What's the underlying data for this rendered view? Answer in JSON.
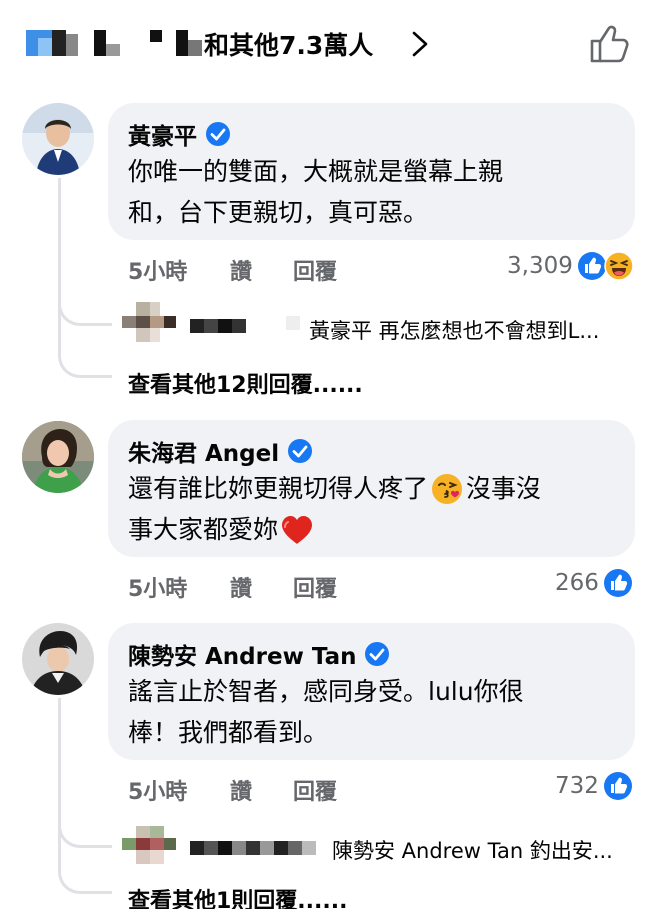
{
  "header": {
    "reactions_text": "和其他7.3萬人"
  },
  "comments": [
    {
      "author": "黃豪平",
      "lines": [
        "你唯一的雙面，大概就是螢幕上親",
        "和，台下更親切，真可惡。"
      ],
      "time": "5小時",
      "like_label": "讚",
      "reply_label": "回覆",
      "reaction_count": "3,309",
      "reactions": [
        "like-icon",
        "haha-icon"
      ],
      "reply_preview": "黃豪平 再怎麼想也不會想到L...",
      "more_replies": "查看其他12則回覆......"
    },
    {
      "author": "朱海君 Angel",
      "lines": [
        "還有誰比妳更親切得人疼了",
        "事大家都愛妳"
      ],
      "line1_tail": "沒事沒",
      "time": "5小時",
      "like_label": "讚",
      "reply_label": "回覆",
      "reaction_count": "266",
      "reactions": [
        "like-icon"
      ]
    },
    {
      "author": "陳勢安 Andrew Tan",
      "lines": [
        "謠言止於智者，感同身受。lulu你很",
        "棒！我們都看到。"
      ],
      "time": "5小時",
      "like_label": "讚",
      "reply_label": "回覆",
      "reaction_count": "732",
      "reactions": [
        "like-icon"
      ],
      "reply_preview": "陳勢安 Andrew Tan 釣出安...",
      "more_replies": "查看其他1則回覆......"
    }
  ],
  "colors": {
    "accent": "#1877f2",
    "bubble": "#f0f2f5",
    "muted": "#65676b",
    "text": "#050505"
  }
}
